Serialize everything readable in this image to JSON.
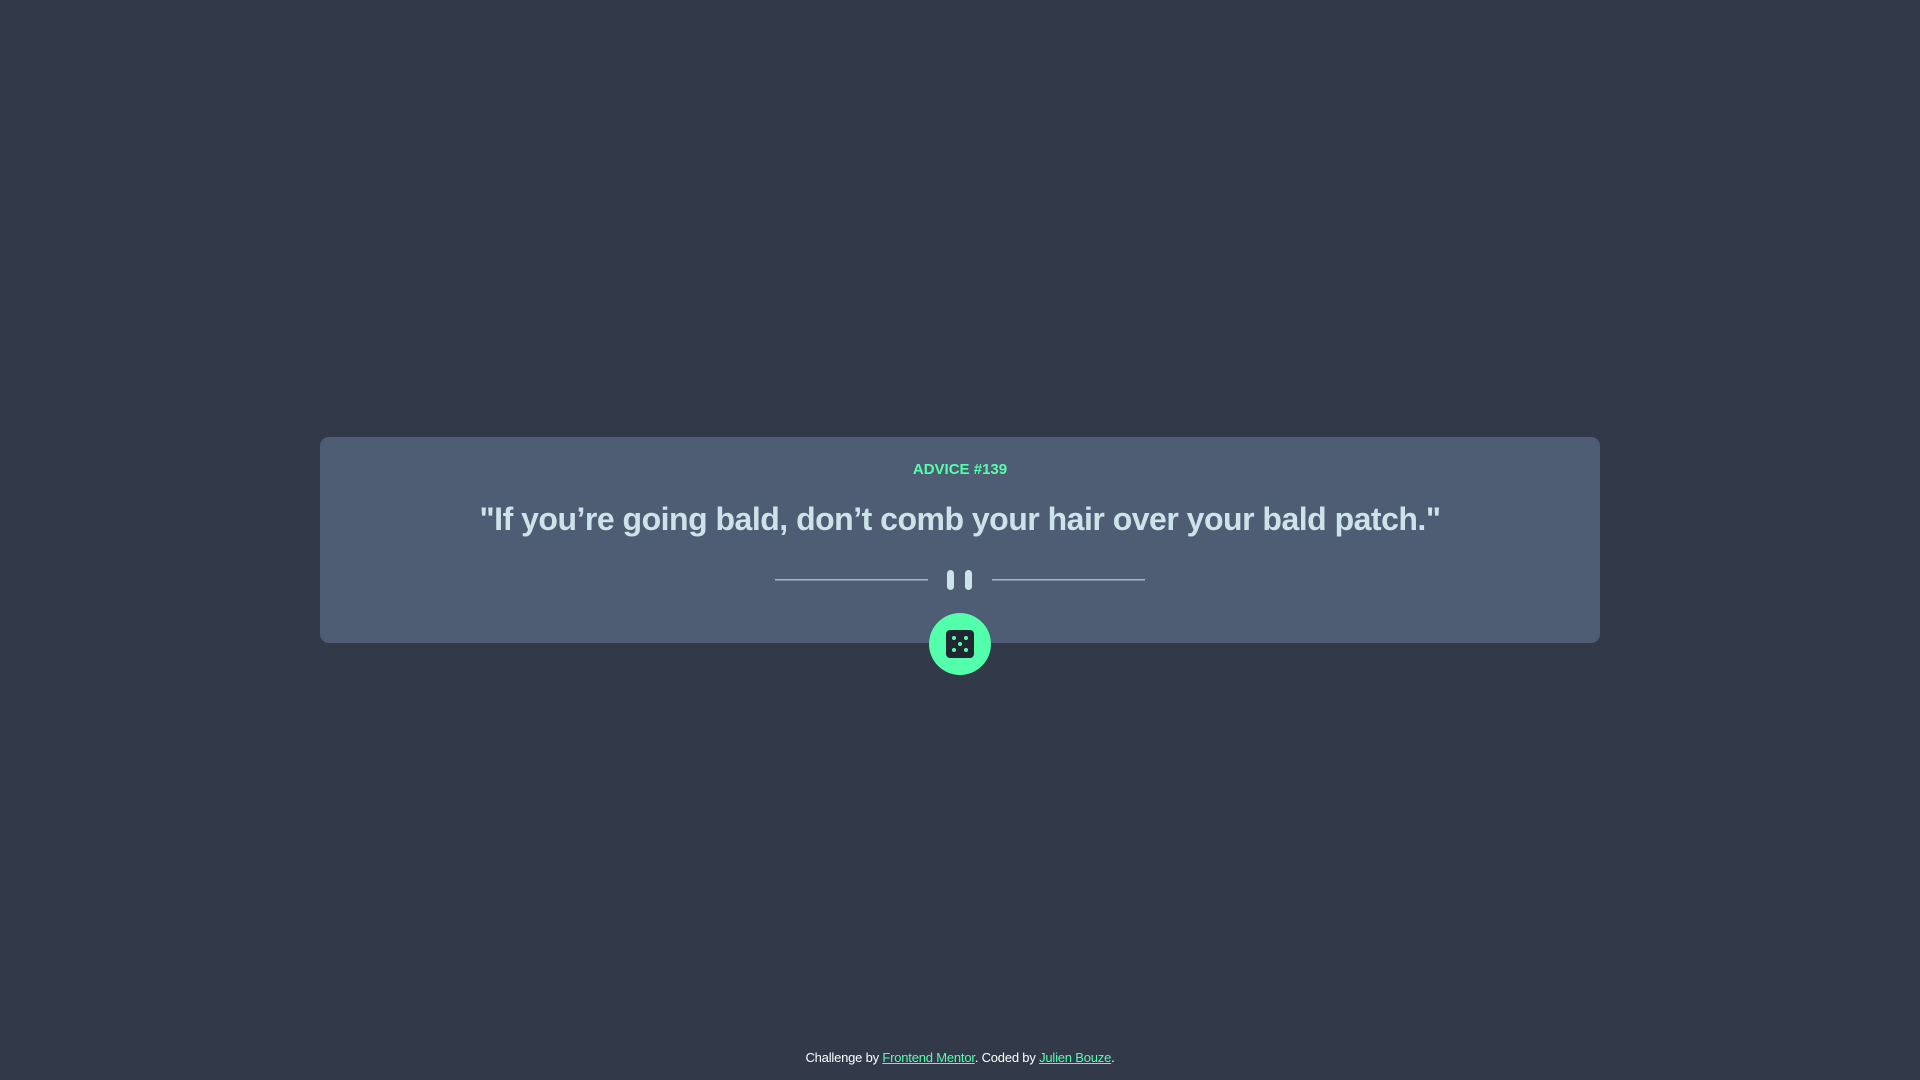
{
  "card": {
    "advice_label": "ADVICE #139",
    "quote": "\"If you’re going bald, don’t comb your hair over your bald patch.\""
  },
  "icons": {
    "divider": "pause-divider-icon",
    "dice": "dice-icon"
  },
  "footer": {
    "prefix": "Challenge by ",
    "link1": "Frontend Mentor",
    "middle": ". Coded by ",
    "link2": "Julien Bouze",
    "suffix": "."
  },
  "colors": {
    "background": "#323a49",
    "card": "#4e5d73",
    "accent": "#53ffaa",
    "quote_text": "#cee3e9"
  }
}
